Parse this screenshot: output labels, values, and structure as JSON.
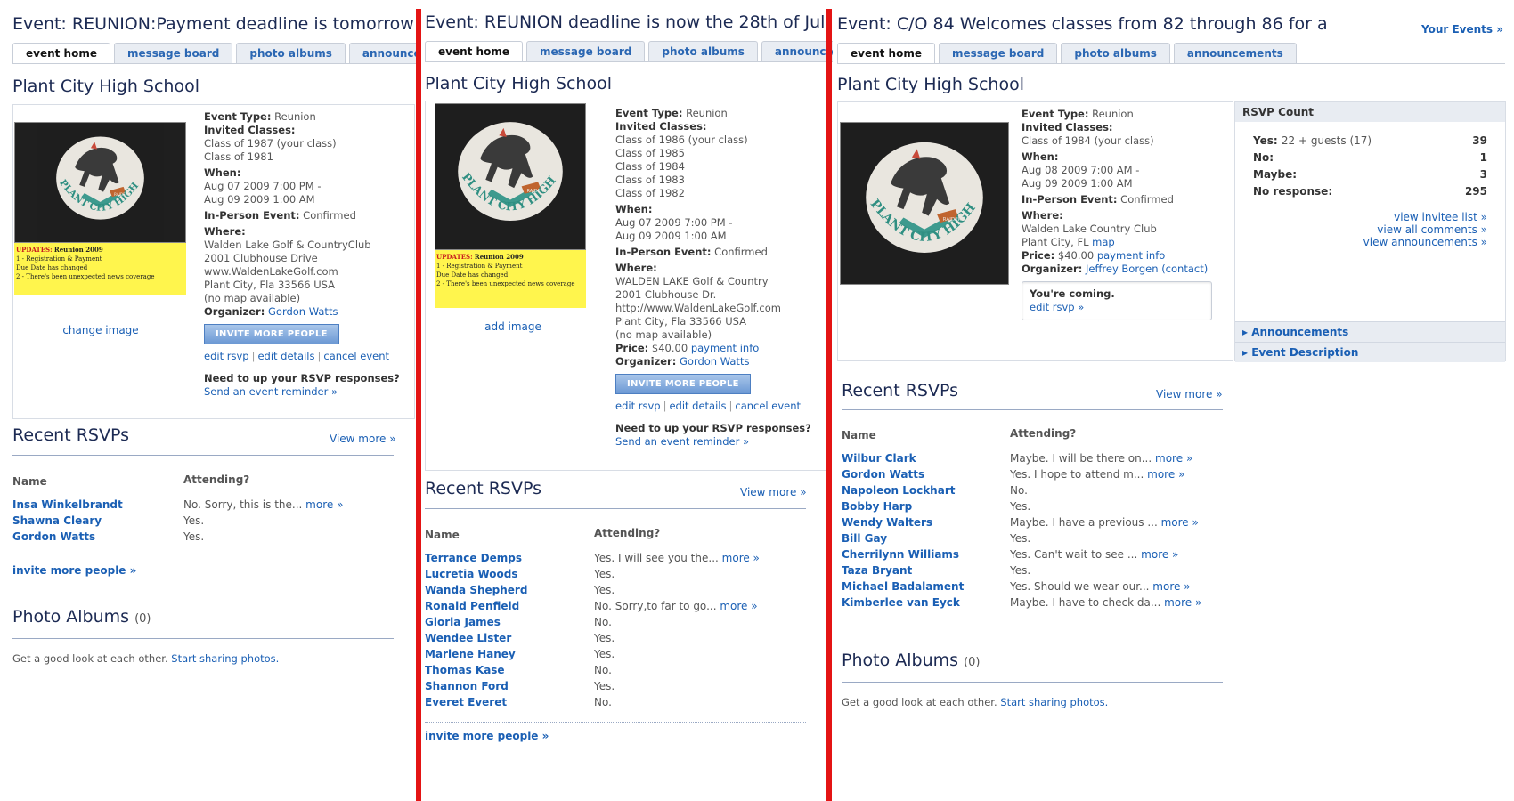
{
  "colors": {
    "link": "#1a5fb4",
    "divider": "#e41414",
    "title": "#1c2a53"
  },
  "common": {
    "tabs": [
      "event home",
      "message board",
      "photo albums",
      "announcements"
    ],
    "school": "Plant City High School",
    "labels": {
      "event_type": "Event Type:",
      "invited": "Invited Classes:",
      "when": "When:",
      "in_person": "In-Person Event:",
      "where": "Where:",
      "price": "Price:",
      "organizer": "Organizer:"
    },
    "invite_button": "INVITE MORE PEOPLE",
    "edit_rsvp": "edit rsvp",
    "edit_details": "edit details",
    "cancel_event": "cancel event",
    "reminder_q": "Need to up your RSVP responses?",
    "reminder_link": "Send an event reminder »",
    "recent_rsvps": "Recent RSVPs",
    "view_more": "View more »",
    "col_name": "Name",
    "col_attending": "Attending?",
    "invite_more_link": "invite more people »",
    "photo_albums": "Photo Albums",
    "photo_count": "(0)",
    "share_text": "Get a good look at each other.",
    "share_link": "Start sharing photos.",
    "more": "more »",
    "logo_text": "PLANT CITY HIGH SCHOOL",
    "logo_badge": "RAIDERS",
    "update_title": "UPDATES:",
    "update_title2": "Reunion 2009",
    "update_line1": "1 - Registration & Payment",
    "update_line1b": "Due Date has changed",
    "update_line2": "2 - There's been unexpected news coverage"
  },
  "panel1": {
    "title": "Event: REUNION:Payment deadline is tomorrow",
    "event_type": "Reunion",
    "classes": [
      "Class of 1987 (your class)",
      "Class of 1981"
    ],
    "when": [
      "Aug 07 2009 7:00 PM -",
      "Aug 09 2009 1:00 AM"
    ],
    "in_person": "Confirmed",
    "where": [
      "Walden Lake Golf & CountryClub",
      "2001 Clubhouse Drive",
      "www.WaldenLakeGolf.com",
      "Plant City, Fla 33566 USA",
      "(no map available)"
    ],
    "organizer": "Gordon Watts",
    "image_link": "change image",
    "rsvps": [
      {
        "name": "Insa Winkelbrandt",
        "status": "No. Sorry, this is the...",
        "more": true
      },
      {
        "name": "Shawna Cleary",
        "status": "Yes.",
        "more": false
      },
      {
        "name": "Gordon Watts",
        "status": "Yes.",
        "more": false
      }
    ]
  },
  "panel2": {
    "title": "Event: REUNION deadline is now the 28th of Jul",
    "event_type": "Reunion",
    "classes": [
      "Class of 1986 (your class)",
      "Class of 1985",
      "Class of 1984",
      "Class of 1983",
      "Class of 1982"
    ],
    "when": [
      "Aug 07 2009 7:00 PM -",
      "Aug 09 2009 1:00 AM"
    ],
    "in_person": "Confirmed",
    "where": [
      "WALDEN LAKE Golf & Country",
      "2001 Clubhouse Dr.",
      "http://www.WaldenLakeGolf.com",
      "Plant City, Fla 33566 USA",
      "(no map available)"
    ],
    "price": "$40.00",
    "price_link": "payment info",
    "organizer": "Gordon Watts",
    "image_link": "add image",
    "rsvps": [
      {
        "name": "Terrance Demps",
        "status": "Yes. I will see you the...",
        "more": true
      },
      {
        "name": "Lucretia Woods",
        "status": "Yes.",
        "more": false
      },
      {
        "name": "Wanda Shepherd",
        "status": "Yes.",
        "more": false
      },
      {
        "name": "Ronald Penfield",
        "status": "No. Sorry,to far to go...",
        "more": true
      },
      {
        "name": "Gloria James",
        "status": "No.",
        "more": false
      },
      {
        "name": "Wendee Lister",
        "status": "Yes.",
        "more": false
      },
      {
        "name": "Marlene Haney",
        "status": "Yes.",
        "more": false
      },
      {
        "name": "Thomas Kase",
        "status": "No.",
        "more": false
      },
      {
        "name": "Shannon Ford",
        "status": "Yes.",
        "more": false
      },
      {
        "name": "Everet Everet",
        "status": "No.",
        "more": false
      }
    ]
  },
  "panel3": {
    "title": "Event: C/O 84 Welcomes classes from 82 through 86 for a",
    "your_events": "Your Events »",
    "event_type": "Reunion",
    "classes": [
      "Class of 1984 (your class)"
    ],
    "when": [
      "Aug 08 2009 7:00 AM -",
      "Aug 09 2009 1:00 AM"
    ],
    "in_person": "Confirmed",
    "where": [
      "Walden Lake Country Club",
      "Plant City, FL"
    ],
    "map_link": "map",
    "price": "$40.00",
    "price_link": "payment info",
    "organizer": "Jeffrey Borgen",
    "contact": "(contact)",
    "coming": "You're coming.",
    "coming_edit": "edit rsvp »",
    "rsvp_count": {
      "title": "RSVP Count",
      "yes_label": "Yes:",
      "yes_detail": "22 + guests (17)",
      "yes": "39",
      "no_label": "No:",
      "no": "1",
      "maybe_label": "Maybe:",
      "maybe": "3",
      "none_label": "No response:",
      "none": "295",
      "links": [
        "view invitee list »",
        "view all comments »",
        "view announcements »"
      ],
      "announcements": "Announcements",
      "description": "Event Description"
    },
    "rsvps": [
      {
        "name": "Wilbur Clark",
        "status": "Maybe. I will be there on...",
        "more": true
      },
      {
        "name": "Gordon Watts",
        "status": "Yes. I hope to attend m...",
        "more": true
      },
      {
        "name": "Napoleon Lockhart",
        "status": "No.",
        "more": false
      },
      {
        "name": "Bobby Harp",
        "status": "Yes.",
        "more": false
      },
      {
        "name": "Wendy Walters",
        "status": "Maybe. I have a previous ...",
        "more": true
      },
      {
        "name": "Bill Gay",
        "status": "Yes.",
        "more": false
      },
      {
        "name": "Cherrilynn Williams",
        "status": "Yes. Can't wait to see ...",
        "more": true
      },
      {
        "name": "Taza Bryant",
        "status": "Yes.",
        "more": false
      },
      {
        "name": "Michael Badalament",
        "status": "Yes. Should we wear our...",
        "more": true
      },
      {
        "name": "Kimberlee van Eyck",
        "status": "Maybe. I have to check da...",
        "more": true
      }
    ]
  }
}
